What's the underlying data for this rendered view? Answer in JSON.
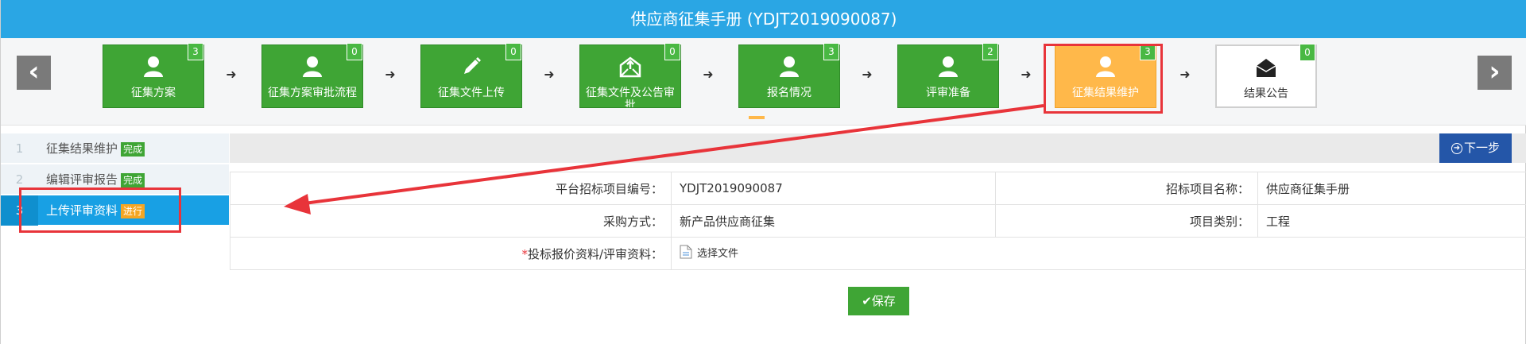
{
  "window": {
    "title": "供应商征集手册 (YDJT2019090087)"
  },
  "steps": [
    {
      "label": "征集方案",
      "badge": "3",
      "icon": "user-icon",
      "state": "done"
    },
    {
      "label": "征集方案审批流程",
      "badge": "0",
      "icon": "user-icon",
      "state": "done"
    },
    {
      "label": "征集文件上传",
      "badge": "0",
      "icon": "pencil-icon",
      "state": "done"
    },
    {
      "label": "征集文件及公告审批",
      "badge": "0",
      "icon": "envelope-upload-icon",
      "state": "done"
    },
    {
      "label": "报名情况",
      "badge": "3",
      "icon": "user-icon",
      "state": "done"
    },
    {
      "label": "评审准备",
      "badge": "2",
      "icon": "user-icon",
      "state": "done"
    },
    {
      "label": "征集结果维护",
      "badge": "3",
      "icon": "user-icon",
      "state": "active"
    },
    {
      "label": "结果公告",
      "badge": "0",
      "icon": "envelope-icon",
      "state": "pending"
    }
  ],
  "nav": {
    "prev": "‹",
    "next": "›"
  },
  "sidebar": {
    "items": [
      {
        "num": "1",
        "label": "征集结果维护",
        "tag": "完成"
      },
      {
        "num": "2",
        "label": "编辑评审报告",
        "tag": "完成"
      },
      {
        "num": "3",
        "label": "上传评审资料",
        "tag": "进行"
      }
    ]
  },
  "toolbar": {
    "next_label": "下一步"
  },
  "form": {
    "row1": {
      "label1": "平台招标项目编号：",
      "value1": "YDJT2019090087",
      "label2": "招标项目名称：",
      "value2": "供应商征集手册"
    },
    "row2": {
      "label1": "采购方式：",
      "value1": "新产品供应商征集",
      "label2": "项目类别：",
      "value2": "工程"
    },
    "row3": {
      "required_mark": "*",
      "label": "投标报价资料/评审资料：",
      "file_button": "选择文件"
    }
  },
  "actions": {
    "save_label": "保存"
  },
  "colors": {
    "title_bar": "#2aa6e4",
    "step_done": "#3fa535",
    "step_active": "#ffb84a",
    "highlight": "#e8343a",
    "sidebar_current": "#18a0e4",
    "next_button": "#2456a8"
  }
}
